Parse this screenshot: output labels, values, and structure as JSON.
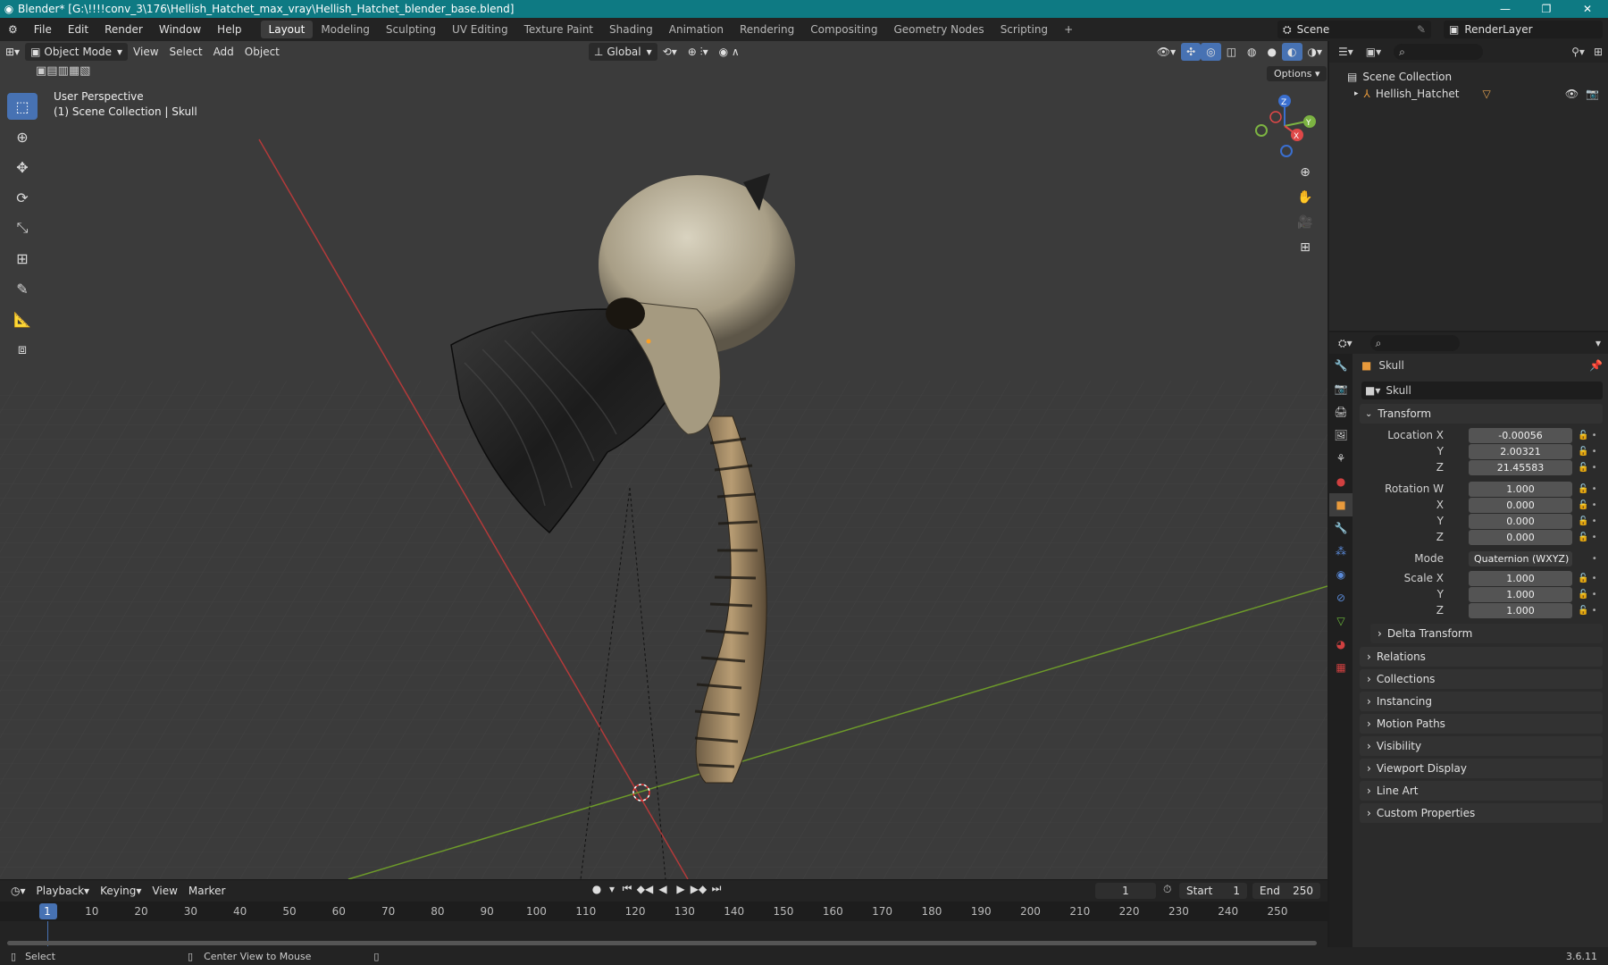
{
  "window": {
    "title": "Blender* [G:\\!!!!conv_3\\176\\Hellish_Hatchet_max_vray\\Hellish_Hatchet_blender_base.blend]",
    "minimize": "—",
    "maximize": "❐",
    "close": "✕"
  },
  "menu": [
    "File",
    "Edit",
    "Render",
    "Window",
    "Help"
  ],
  "workspaces": [
    "Layout",
    "Modeling",
    "Sculpting",
    "UV Editing",
    "Texture Paint",
    "Shading",
    "Animation",
    "Rendering",
    "Compositing",
    "Geometry Nodes",
    "Scripting"
  ],
  "workspace_add": "+",
  "scene": {
    "name": "Scene",
    "render_layer": "RenderLayer"
  },
  "viewport": {
    "mode": "Object Mode",
    "menus": [
      "View",
      "Select",
      "Add",
      "Object"
    ],
    "orientation": "Global",
    "options": "Options",
    "info_line1": "User Perspective",
    "info_line2": "(1) Scene Collection | Skull",
    "gizmo": {
      "z": "Z",
      "y": "Y",
      "x": "X"
    }
  },
  "outliner": {
    "root": "Scene Collection",
    "items": [
      {
        "label": "Hellish_Hatchet"
      }
    ]
  },
  "properties": {
    "object_name": "Skull",
    "data_name": "Skull",
    "transform_title": "Transform",
    "location_label": "Location X",
    "location": {
      "x": "-0.00056",
      "y": "2.00321",
      "z": "21.45583"
    },
    "rotation_label": "Rotation W",
    "rotation": {
      "w": "1.000",
      "x": "0.000",
      "y": "0.000",
      "z": "0.000"
    },
    "mode_label": "Mode",
    "mode_value": "Quaternion (WXYZ)",
    "scale_label": "Scale X",
    "scale": {
      "x": "1.000",
      "y": "1.000",
      "z": "1.000"
    },
    "axis_y": "Y",
    "axis_z": "Z",
    "axis_x": "X",
    "delta_transform": "Delta Transform",
    "panels": [
      "Relations",
      "Collections",
      "Instancing",
      "Motion Paths",
      "Visibility",
      "Viewport Display",
      "Line Art",
      "Custom Properties"
    ]
  },
  "timeline": {
    "menus": [
      "Playback",
      "Keying",
      "View",
      "Marker"
    ],
    "current_frame": "1",
    "start_label": "Start",
    "start": "1",
    "end_label": "End",
    "end": "250",
    "ticks": [
      "1",
      "10",
      "20",
      "30",
      "40",
      "50",
      "60",
      "70",
      "80",
      "90",
      "100",
      "110",
      "120",
      "130",
      "140",
      "150",
      "160",
      "170",
      "180",
      "190",
      "200",
      "210",
      "220",
      "230",
      "240",
      "250"
    ]
  },
  "status": {
    "select": "Select",
    "center_view": "Center View to Mouse",
    "version": "3.6.11"
  },
  "colors": {
    "accent": "#4772b3",
    "titlebar": "#0e7a83",
    "x_axis": "#b33a3a",
    "y_axis": "#6d9a2a"
  }
}
